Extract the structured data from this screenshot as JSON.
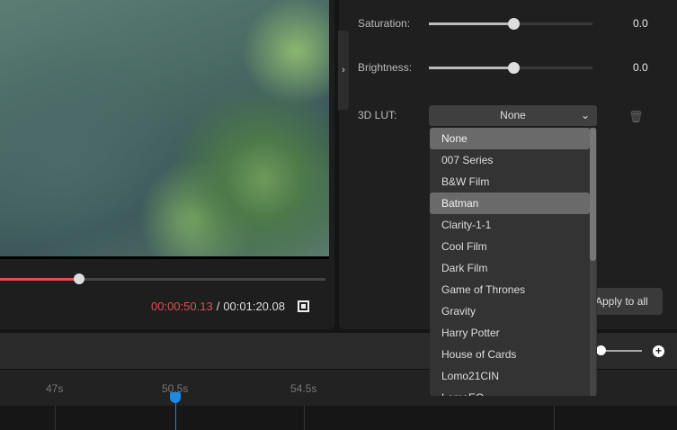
{
  "player": {
    "progress_percent": 62.6,
    "current_time": "00:00:50.13",
    "separator": "/",
    "total_time": "00:01:20.08"
  },
  "adjust": {
    "saturation_label": "Saturation:",
    "saturation_value": "0.0",
    "saturation_percent": 50,
    "brightness_label": "Brightness:",
    "brightness_value": "0.0",
    "brightness_percent": 50,
    "lut_label": "3D LUT:",
    "lut_selected": "None"
  },
  "lut_options": [
    "None",
    "007 Series",
    "B&W Film",
    "Batman",
    "Clarity-1-1",
    "Cool Film",
    "Dark Film",
    "Game of Thrones",
    "Gravity",
    "Harry Potter",
    "House of Cards",
    "Lomo21CIN",
    "LomoEO"
  ],
  "apply_all_label": "Apply to all",
  "timeline": {
    "ticks": [
      "47s",
      "50.5s",
      "54.5s"
    ]
  },
  "icons": {
    "collapse": "›",
    "chevron": "⌄",
    "trash": "🗑",
    "plus": "+"
  }
}
